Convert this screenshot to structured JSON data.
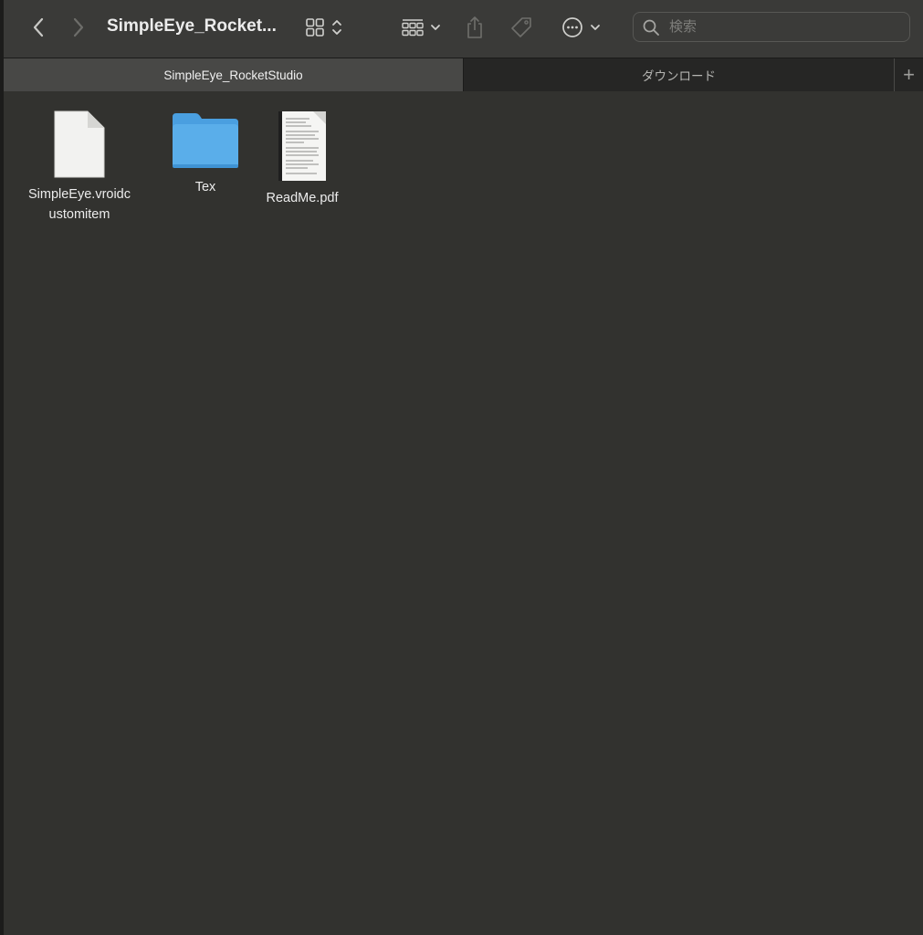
{
  "toolbar": {
    "title": "SimpleEye_Rocket...",
    "back_icon": "chevron-left-icon",
    "forward_icon": "chevron-right-icon",
    "view_icon": "grid-icon",
    "group_icon": "group-grid-icon",
    "share_icon": "share-icon",
    "tag_icon": "tag-icon",
    "action_icon": "ellipsis-circle-icon",
    "search": {
      "placeholder": "検索",
      "value": ""
    }
  },
  "tabs": [
    {
      "label": "SimpleEye_RocketStudio",
      "active": true
    },
    {
      "label": "ダウンロード",
      "active": false
    }
  ],
  "tab_add_label": "+",
  "files": [
    {
      "name_line1": "SimpleEye.vroidc",
      "name_line2": "ustomitem",
      "kind": "document-icon"
    },
    {
      "name_line1": "Tex",
      "kind": "folder-icon"
    },
    {
      "name_line1": "ReadMe.pdf",
      "kind": "pdf-icon"
    }
  ],
  "colors": {
    "folder": "#5aaeea",
    "background": "#32322f"
  }
}
